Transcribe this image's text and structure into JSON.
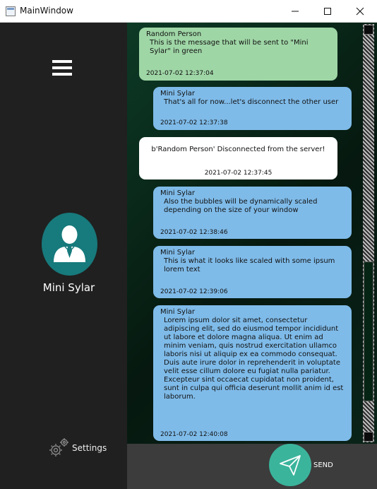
{
  "window": {
    "title": "MainWindow"
  },
  "sidebar": {
    "user_name": "Mini Sylar",
    "settings_label": "Settings"
  },
  "messages": [
    {
      "sender": "Random Person",
      "text": "This is the message that will be sent to \"Mini Sylar\" in green",
      "time": "2021-07-02 12:37:04",
      "style": "green"
    },
    {
      "sender": "Mini Sylar",
      "text": "That's all for now...let's disconnect the other user",
      "time": "2021-07-02 12:37:38",
      "style": "blue"
    },
    {
      "sender": "",
      "text": "b'Random Person' Disconnected from the server!",
      "time": "2021-07-02 12:37:45",
      "style": "system"
    },
    {
      "sender": "Mini Sylar",
      "text": "Also the bubbles will be dynamically scaled depending on the size of your window",
      "time": "2021-07-02 12:38:46",
      "style": "blue"
    },
    {
      "sender": "Mini Sylar",
      "text": "This is what it looks like scaled with some ipsum lorem text",
      "time": "2021-07-02 12:39:06",
      "style": "blue"
    },
    {
      "sender": "Mini Sylar",
      "text": "Lorem ipsum dolor sit amet, consectetur adipiscing elit, sed do eiusmod tempor incididunt ut labore et dolore magna aliqua. Ut enim ad minim veniam, quis nostrud exercitation ullamco laboris nisi ut aliquip ex ea commodo consequat. Duis aute irure dolor in reprehenderit in voluptate velit esse cillum dolore eu fugiat nulla pariatur. Excepteur sint occaecat cupidatat non proident, sunt in culpa qui officia deserunt mollit anim id est laborum.",
      "time": "2021-07-02 12:40:08",
      "style": "blue"
    }
  ],
  "composer": {
    "send_label": "SEND"
  },
  "icons": {
    "menu": "hamburger-icon",
    "avatar": "user-avatar-icon",
    "settings": "gear-icon",
    "send": "paper-plane-icon"
  },
  "colors": {
    "accent": "#177a7c",
    "send": "#3bb49c",
    "bubble_green": "#9fd6a6",
    "bubble_blue": "#7fbbe9"
  }
}
